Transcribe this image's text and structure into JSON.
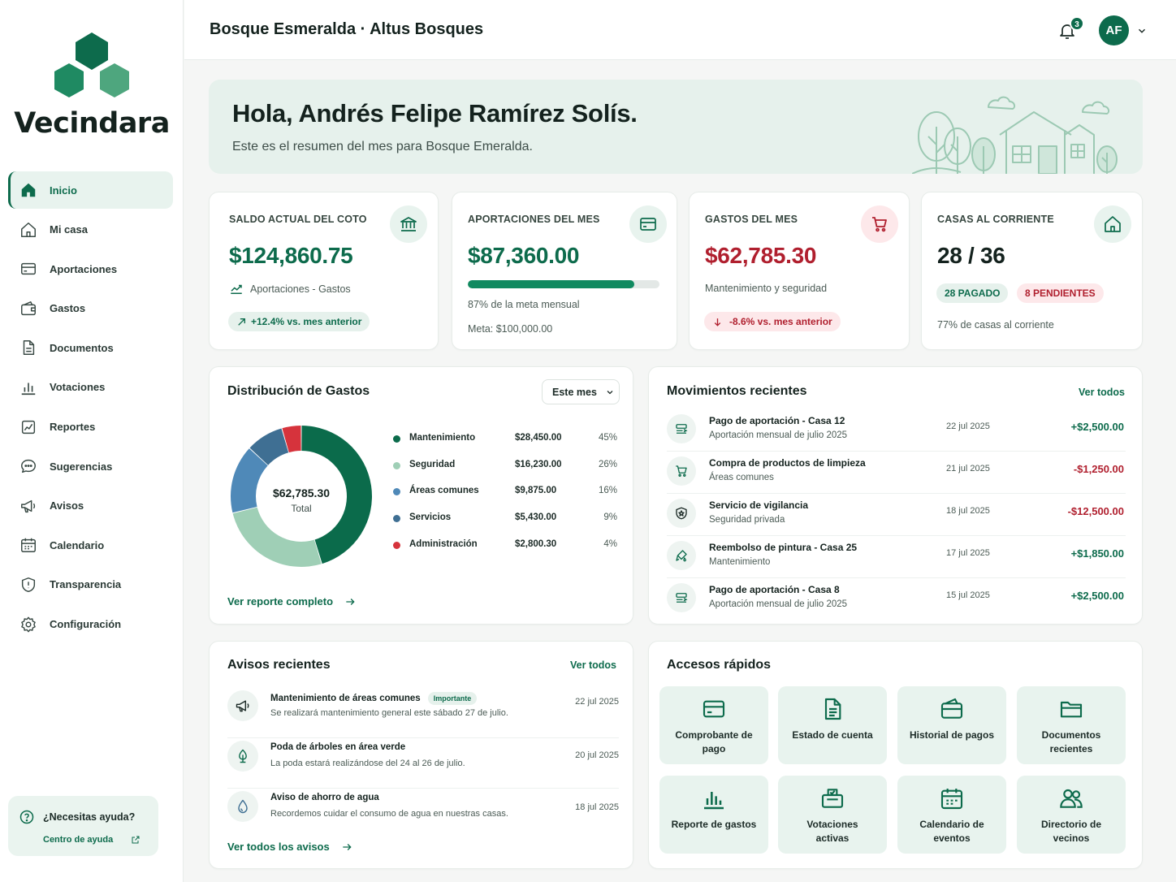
{
  "app": {
    "name": "Vecindara",
    "title": "Bosque Esmeralda · Altus Bosques"
  },
  "colors": {
    "primary": "#0d6b4c",
    "light": "#e8f3ee",
    "danger": "#b01f2e",
    "danger_bg": "#fde8ea"
  },
  "nav": [
    {
      "label": "Inicio",
      "icon": "home-filled-icon",
      "active": true
    },
    {
      "label": "Mi casa",
      "icon": "house-icon"
    },
    {
      "label": "Aportaciones",
      "icon": "card-icon"
    },
    {
      "label": "Gastos",
      "icon": "wallet-icon"
    },
    {
      "label": "Documentos",
      "icon": "document-icon"
    },
    {
      "label": "Votaciones",
      "icon": "bar-chart-icon"
    },
    {
      "label": "Reportes",
      "icon": "report-icon"
    },
    {
      "label": "Sugerencias",
      "icon": "chat-icon"
    },
    {
      "label": "Avisos",
      "icon": "megaphone-icon"
    },
    {
      "label": "Calendario",
      "icon": "calendar-icon"
    },
    {
      "label": "Transparencia",
      "icon": "shield-icon"
    },
    {
      "label": "Configuración",
      "icon": "gear-icon"
    }
  ],
  "help": {
    "title": "¿Necesitas ayuda?",
    "link": "Centro de ayuda"
  },
  "header": {
    "notifications": "3",
    "avatar": "AF"
  },
  "hero": {
    "greeting": "Hola, Andrés Felipe Ramírez Solís.",
    "subtitle": "Este es el resumen del mes para Bosque Emeralda."
  },
  "stats": {
    "saldo": {
      "label": "SALDO ACTUAL DEL COTO",
      "value": "$124,860.75",
      "sub": "Aportaciones - Gastos",
      "trend": "+12.4% vs. mes anterior"
    },
    "aportaciones": {
      "label": "APORTACIONES DEL MES",
      "value": "$87,360.00",
      "progress": 0.87,
      "progress_text": "87% de la meta mensual",
      "meta": "Meta: $100,000.00"
    },
    "gastos": {
      "label": "GASTOS DEL MES",
      "value": "$62,785.30",
      "sub": "Mantenimiento y seguridad",
      "trend": "-8.6% vs. mes anterior"
    },
    "casas": {
      "label": "CASAS AL CORRIENTE",
      "value": "28 / 36",
      "paid": "28 PAGADO",
      "pending": "8 PENDIENTES",
      "sub": "77% de casas al corriente"
    }
  },
  "distribucion": {
    "title": "Distribución de Gastos",
    "period": "Este mes",
    "total": "$62,785.30",
    "total_label": "Total",
    "link": "Ver reporte completo",
    "items": [
      {
        "name": "Mantenimiento",
        "amount": "$28,450.00",
        "pct": "45%",
        "color": "#0b6b4b"
      },
      {
        "name": "Seguridad",
        "amount": "$16,230.00",
        "pct": "26%",
        "color": "#9fcfb6"
      },
      {
        "name": "Áreas comunes",
        "amount": "$9,875.00",
        "pct": "16%",
        "color": "#4f89b8"
      },
      {
        "name": "Servicios",
        "amount": "$5,430.00",
        "pct": "9%",
        "color": "#3f6f93"
      },
      {
        "name": "Administración",
        "amount": "$2,800.30",
        "pct": "4%",
        "color": "#d6333c"
      }
    ]
  },
  "chart_data": {
    "type": "pie",
    "categories": [
      "Mantenimiento",
      "Seguridad",
      "Áreas comunes",
      "Servicios",
      "Administración"
    ],
    "values": [
      28450.0,
      16230.0,
      9875.0,
      5430.0,
      2800.3
    ]
  },
  "movimientos": {
    "title": "Movimientos recientes",
    "link": "Ver todos",
    "items": [
      {
        "title": "Pago de aportación - Casa 12",
        "sub": "Aportación mensual de julio 2025",
        "date": "22 jul 2025",
        "amount": "+$2,500.00",
        "positive": true,
        "icon": "payment-icon"
      },
      {
        "title": "Compra de productos de limpieza",
        "sub": "Áreas comunes",
        "date": "21 jul 2025",
        "amount": "-$1,250.00",
        "positive": false,
        "icon": "cart-icon"
      },
      {
        "title": "Servicio de vigilancia",
        "sub": "Seguridad privada",
        "date": "18 jul 2025",
        "amount": "-$12,500.00",
        "positive": false,
        "icon": "security-badge-icon"
      },
      {
        "title": "Reembolso de pintura - Casa 25",
        "sub": "Mantenimiento",
        "date": "17 jul 2025",
        "amount": "+$1,850.00",
        "positive": true,
        "icon": "paint-icon"
      },
      {
        "title": "Pago de aportación - Casa 8",
        "sub": "Aportación mensual de julio 2025",
        "date": "15 jul 2025",
        "amount": "+$2,500.00",
        "positive": true,
        "icon": "payment-icon"
      }
    ]
  },
  "avisos": {
    "title": "Avisos recientes",
    "link": "Ver todos",
    "footer": "Ver todos los avisos",
    "items": [
      {
        "title": "Mantenimiento de áreas comunes",
        "tag": "Importante",
        "sub": "Se realizará mantenimiento general este sábado 27 de julio.",
        "date": "22 jul 2025",
        "icon": "megaphone-icon"
      },
      {
        "title": "Poda de árboles en área verde",
        "sub": "La poda estará realizándose del 24 al 26 de julio.",
        "date": "20 jul 2025",
        "icon": "tree-icon"
      },
      {
        "title": "Aviso de ahorro de agua",
        "sub": "Recordemos cuidar el consumo de agua en nuestras casas.",
        "date": "18 jul 2025",
        "icon": "water-drop-icon"
      }
    ]
  },
  "accesos": {
    "title": "Accesos rápidos",
    "items": [
      {
        "label": "Comprobante de pago",
        "icon": "card-icon"
      },
      {
        "label": "Estado de cuenta",
        "icon": "document-icon"
      },
      {
        "label": "Historial de pagos",
        "icon": "wallet-icon"
      },
      {
        "label": "Documentos recientes",
        "icon": "folder-icon"
      },
      {
        "label": "Reporte de gastos",
        "icon": "bar-chart-icon"
      },
      {
        "label": "Votaciones activas",
        "icon": "ballot-box-icon"
      },
      {
        "label": "Calendario de eventos",
        "icon": "calendar-icon"
      },
      {
        "label": "Directorio de vecinos",
        "icon": "users-icon"
      }
    ]
  }
}
